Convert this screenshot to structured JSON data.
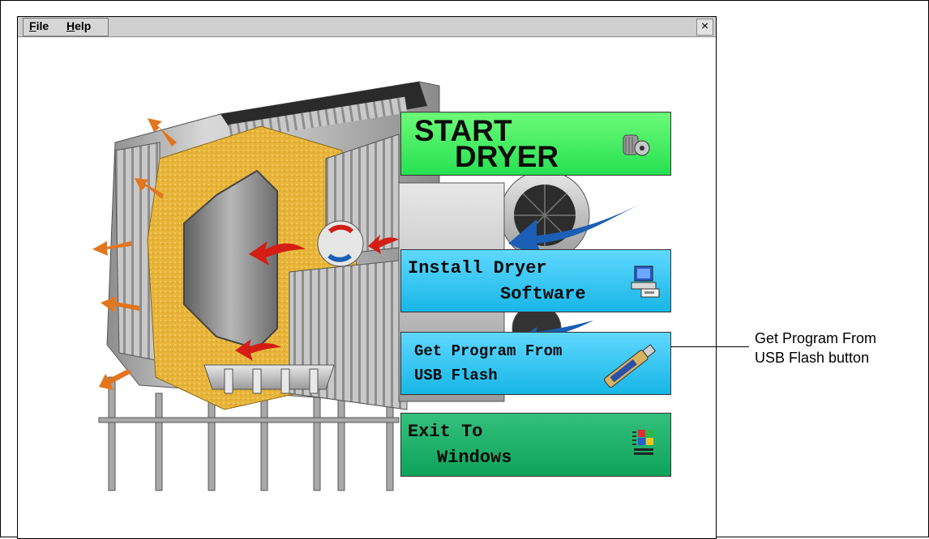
{
  "menubar": {
    "file_label": "File",
    "help_label": "Help",
    "close_label": "×"
  },
  "buttons": {
    "start_line1": "START",
    "start_line2": "DRYER",
    "install_line1": "Install Dryer",
    "install_line2": "Software",
    "usb_line1": "Get Program From",
    "usb_line2": "USB Flash",
    "exit_line1": "Exit To",
    "exit_line2": "Windows"
  },
  "callout": {
    "text": "Get Program From\nUSB Flash button"
  },
  "icons": {
    "start": "gear-dryer-icon",
    "install": "computer-install-icon",
    "usb": "usb-flash-drive-icon",
    "exit": "windows-logo-icon"
  },
  "colors": {
    "start_button": "#3ff068",
    "install_button": "#2ec6f2",
    "usb_button": "#2ec6f2",
    "exit_button": "#1cb069",
    "arrow_orange": "#e2761e",
    "arrow_red": "#d41d14",
    "arrow_blue": "#1a5fb5",
    "grain": "#e8b53a"
  }
}
